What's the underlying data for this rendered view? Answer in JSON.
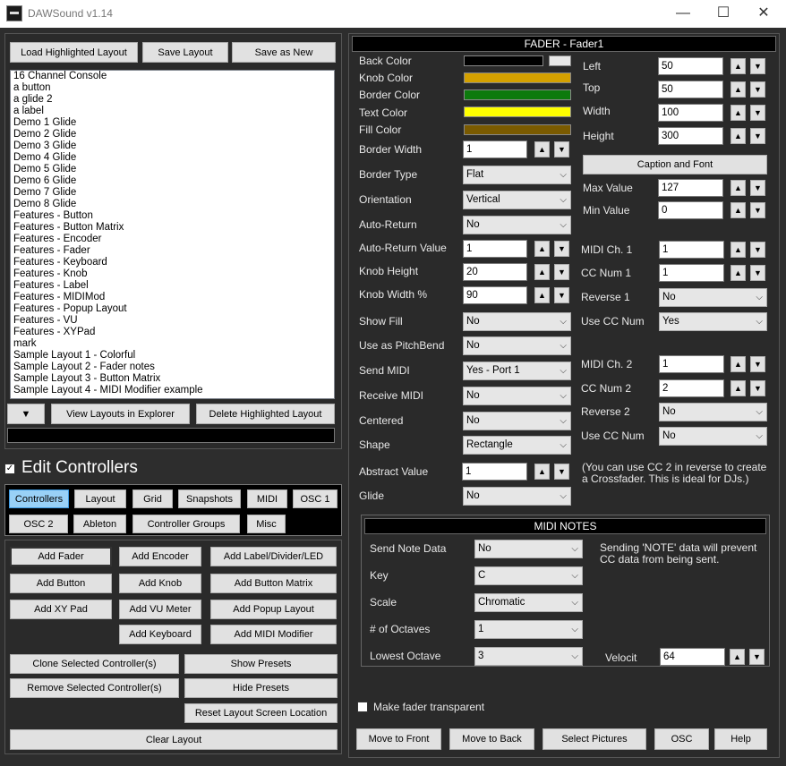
{
  "window": {
    "title": "DAWSound  v1.14",
    "minimize": "—",
    "maximize": "☐",
    "close": "✕"
  },
  "layouts": {
    "load_btn": "Load Highlighted Layout",
    "save_btn": "Save Layout",
    "save_new_btn": "Save as New",
    "items": [
      "16 Channel Console",
      "a button",
      "a glide 2",
      "a label",
      "Demo 1 Glide",
      "Demo 2 Glide",
      "Demo 3 Glide",
      "Demo 4 Glide",
      "Demo 5 Glide",
      "Demo 6 Glide",
      "Demo 7 Glide",
      "Demo 8 Glide",
      "Features - Button",
      "Features - Button Matrix",
      "Features - Encoder",
      "Features - Fader",
      "Features - Keyboard",
      "Features - Knob",
      "Features - Label",
      "Features - MIDIMod",
      "Features - Popup Layout",
      "Features - VU",
      "Features - XYPad",
      "mark",
      "Sample Layout 1 - Colorful",
      "Sample Layout 2 - Fader notes",
      "Sample Layout 3 - Button Matrix",
      "Sample Layout 4 - MIDI Modifier example"
    ],
    "down_btn": "▼",
    "explorer_btn": "View Layouts in Explorer",
    "delete_btn": "Delete Highlighted Layout"
  },
  "edit": {
    "checkbox": "✓",
    "label": "Edit Controllers"
  },
  "tabs": [
    "Controllers",
    "Layout",
    "Grid",
    "Snapshots",
    "MIDI",
    "OSC 1",
    "OSC 2",
    "Ableton",
    "Controller Groups",
    "Misc"
  ],
  "actions": {
    "add_fader": "Add Fader",
    "add_encoder": "Add Encoder",
    "add_label": "Add Label/Divider/LED",
    "add_button": "Add Button",
    "add_knob": "Add Knob",
    "add_button_matrix": "Add Button Matrix",
    "add_xy": "Add XY Pad",
    "add_vu": "Add VU Meter",
    "add_popup": "Add Popup Layout",
    "add_keyboard": "Add Keyboard",
    "add_midi_mod": "Add MIDI Modifier",
    "clone": "Clone Selected Controller(s)",
    "show_presets": "Show Presets",
    "remove": "Remove Selected Controller(s)",
    "hide_presets": "Hide Presets",
    "reset_location": "Reset Layout Screen Location",
    "clear": "Clear Layout"
  },
  "fader": {
    "header": "FADER  -  Fader1",
    "labels": {
      "back_color": "Back Color",
      "knob_color": "Knob Color",
      "border_color": "Border Color",
      "text_color": "Text Color",
      "fill_color": "Fill Color",
      "border_width": "Border Width",
      "border_type": "Border Type",
      "orientation": "Orientation",
      "auto_return": "Auto-Return",
      "auto_return_value": "Auto-Return Value",
      "knob_height": "Knob Height",
      "knob_width": "Knob Width %",
      "show_fill": "Show Fill",
      "use_pitchbend": "Use as PitchBend",
      "send_midi": "Send MIDI",
      "receive_midi": "Receive MIDI",
      "centered": "Centered",
      "shape": "Shape",
      "abstract_value": "Abstract Value",
      "glide": "Glide"
    },
    "colors": {
      "back": "#000000",
      "knob": "#d4a000",
      "border": "#0d7a0d",
      "text": "#ffff00",
      "fill": "#7a5a00"
    },
    "values": {
      "border_width": "1",
      "border_type": "Flat",
      "orientation": "Vertical",
      "auto_return": "No",
      "auto_return_value": "1",
      "knob_height": "20",
      "knob_width": "90",
      "show_fill": "No",
      "use_pitchbend": "No",
      "send_midi": "Yes - Port 1",
      "receive_midi": "No",
      "centered": "No",
      "shape": "Rectangle",
      "abstract_value": "1",
      "glide": "No"
    },
    "geom_labels": {
      "left": "Left",
      "top": "Top",
      "width": "Width",
      "height": "Height"
    },
    "geom": {
      "left": "50",
      "top": "50",
      "width": "100",
      "height": "300"
    },
    "caption_btn": "Caption and Font",
    "max_label": "Max Value",
    "max": "127",
    "min_label": "Min Value",
    "min": "0",
    "midi1": {
      "ch_label": "MIDI Ch. 1",
      "ch": "1",
      "cc_label": "CC Num 1",
      "cc": "1",
      "rev_label": "Reverse 1",
      "rev": "No",
      "use_label": "Use CC Num",
      "use": "Yes"
    },
    "midi2": {
      "ch_label": "MIDI Ch. 2",
      "ch": "1",
      "cc_label": "CC Num 2",
      "cc": "2",
      "rev_label": "Reverse 2",
      "rev": "No",
      "use_label": "Use CC Num",
      "use": "No"
    },
    "note": "(You can use CC 2 in reverse to create a Crossfader. This is ideal for DJs.)"
  },
  "midi_notes": {
    "header": "MIDI NOTES",
    "labels": {
      "send": "Send Note Data",
      "key": "Key",
      "scale": "Scale",
      "octaves": "# of Octaves",
      "lowest": "Lowest Octave",
      "velocity": "Velocit"
    },
    "values": {
      "send": "No",
      "key": "C",
      "scale": "Chromatic",
      "octaves": "1",
      "lowest": "3",
      "velocity": "64"
    },
    "info": "Sending 'NOTE' data will prevent CC data from being sent."
  },
  "transparent_label": "Make fader transparent",
  "bottom": {
    "front": "Move to Front",
    "back": "Move to Back",
    "pictures": "Select Pictures",
    "osc": "OSC",
    "help": "Help"
  }
}
